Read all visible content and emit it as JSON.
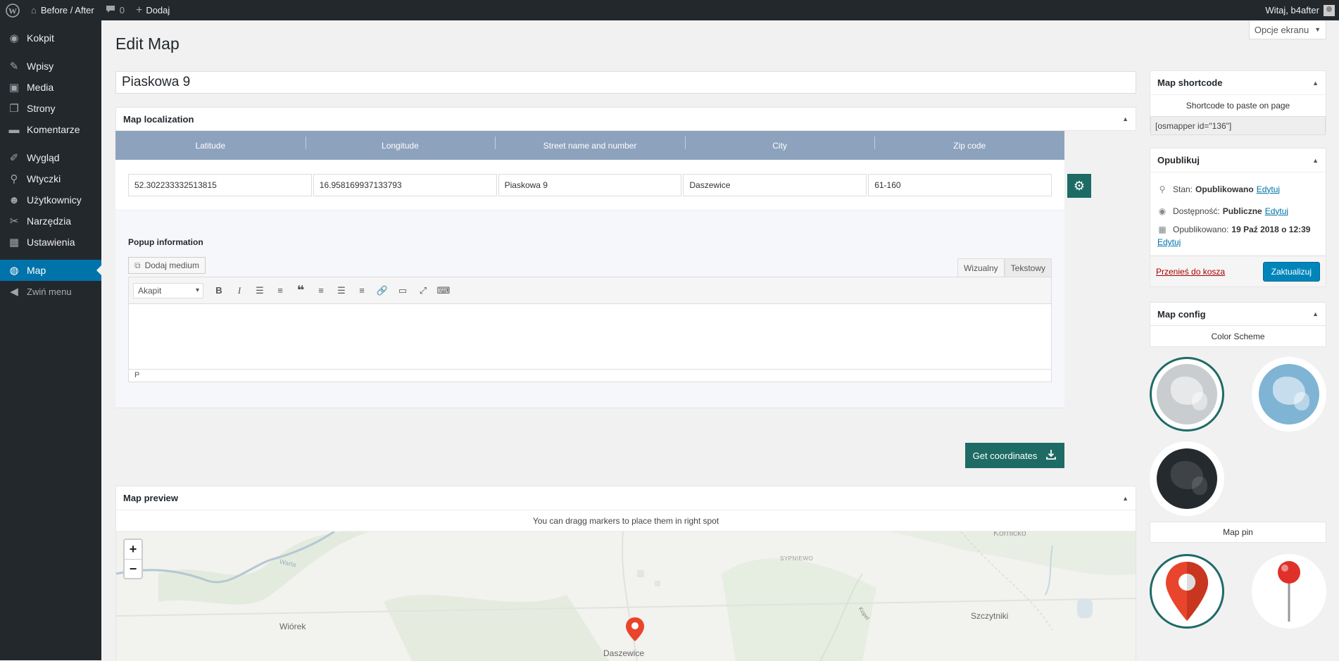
{
  "adminbar": {
    "site_name": "Before / After",
    "comments_count": "0",
    "new_label": "Dodaj",
    "greeting": "Witaj, b4after"
  },
  "sidebar": {
    "items": [
      {
        "label": "Kokpit",
        "icon": "dashboard-icon"
      },
      {
        "label": "Wpisy",
        "icon": "pin-icon"
      },
      {
        "label": "Media",
        "icon": "media-icon"
      },
      {
        "label": "Strony",
        "icon": "pages-icon"
      },
      {
        "label": "Komentarze",
        "icon": "comments-icon"
      },
      {
        "label": "Wygląd",
        "icon": "appearance-icon"
      },
      {
        "label": "Wtyczki",
        "icon": "plugins-icon"
      },
      {
        "label": "Użytkownicy",
        "icon": "users-icon"
      },
      {
        "label": "Narzędzia",
        "icon": "tools-icon"
      },
      {
        "label": "Ustawienia",
        "icon": "settings-icon"
      },
      {
        "label": "Map",
        "icon": "globe-icon"
      }
    ],
    "collapse_label": "Zwiń menu"
  },
  "page": {
    "title": "Edit Map",
    "screen_options": "Opcje ekranu",
    "post_title": "Piaskowa 9"
  },
  "localization": {
    "heading": "Map localization",
    "columns": [
      "Latitude",
      "Longitude",
      "Street name and number",
      "City",
      "Zip code"
    ],
    "values": [
      "52.302233332513815",
      "16.958169937133793",
      "Piaskowa 9",
      "Daszewice",
      "61-160"
    ],
    "popup_label": "Popup information",
    "add_media": "Dodaj medium",
    "tab_visual": "Wizualny",
    "tab_text": "Tekstowy",
    "format_select": "Akapit",
    "status_path": "P"
  },
  "get_coordinates": "Get coordinates",
  "preview": {
    "heading": "Map preview",
    "note": "You can dragg markers to place them in right spot",
    "labels": {
      "wiorek": "Wiórek",
      "daszewice": "Daszewice",
      "szczytniki": "Szczytniki",
      "sypniewo": "SYPNIEWO",
      "warta": "Warta",
      "kopel": "Kopel",
      "kornik": "Kórnicko"
    }
  },
  "shortcode_box": {
    "heading": "Map shortcode",
    "note": "Shortcode to paste on page",
    "value": "[osmapper id=\"136\"]"
  },
  "publish": {
    "heading": "Opublikuj",
    "status_label": "Stan:",
    "status_value": "Opublikowano",
    "visibility_label": "Dostępność:",
    "visibility_value": "Publiczne",
    "published_label": "Opublikowano:",
    "published_value": "19 Paź 2018 o 12:39",
    "edit_link": "Edytuj",
    "trash": "Przenieś do kosza",
    "update": "Zaktualizuj"
  },
  "config": {
    "heading": "Map config",
    "color_scheme": "Color Scheme",
    "map_pin": "Map pin"
  },
  "colors": {
    "sidebar_bg": "#23282d",
    "active_blue": "#0073aa",
    "accent_teal": "#1e6b66",
    "table_header": "#8da2bd",
    "pin_red": "#e8452c"
  }
}
